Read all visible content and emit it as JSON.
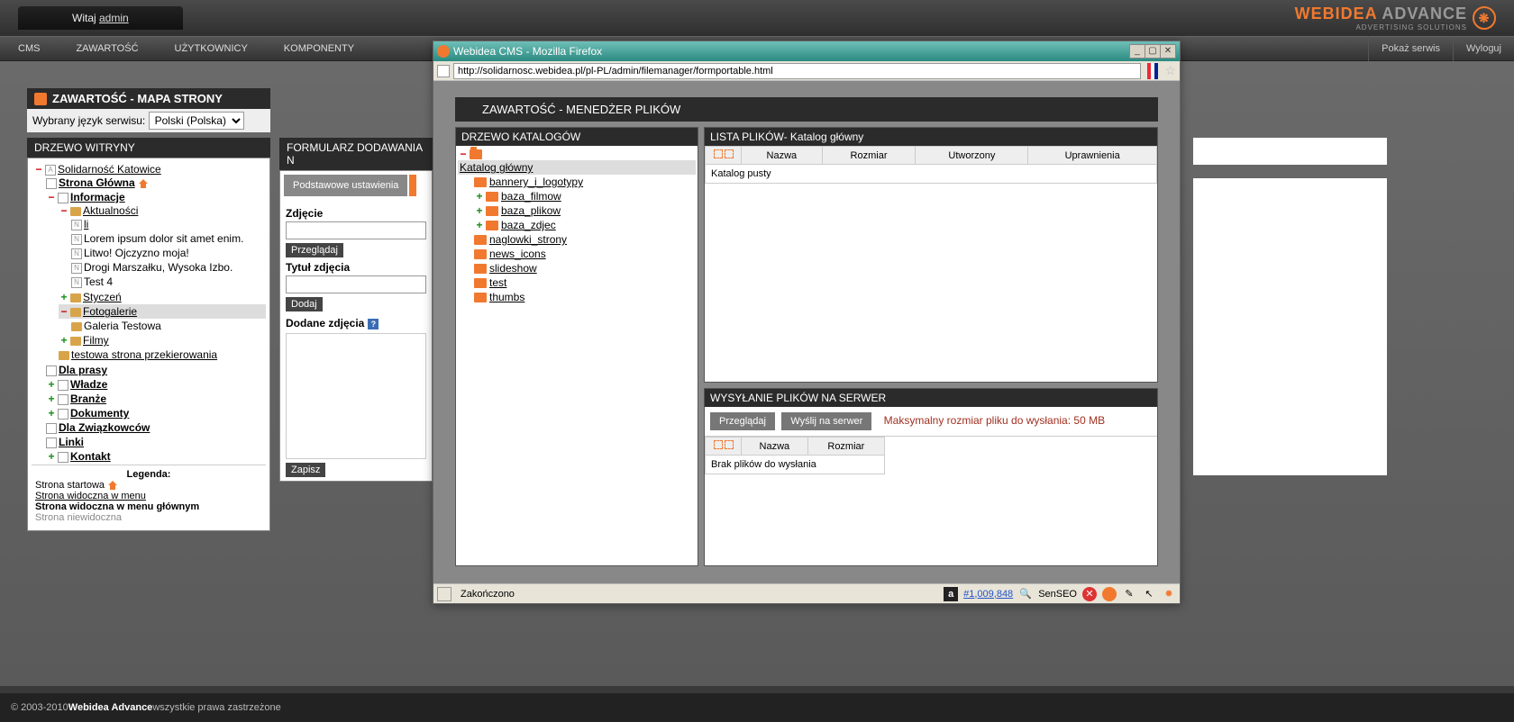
{
  "topbar": {
    "welcome_prefix": "Witaj ",
    "welcome_user": "admin"
  },
  "brand": {
    "name": "WEBIDEA",
    "name2": "ADVANCE",
    "sub": "ADVERTISING SOLUTIONS"
  },
  "menu": {
    "cms": "CMS",
    "zawartosc": "ZAWARTOŚĆ",
    "uzytkownicy": "UŻYTKOWNICY",
    "komponenty": "KOMPONENTY",
    "pokaz": "Pokaż serwis",
    "wyloguj": "Wyloguj"
  },
  "sitemap": {
    "header": "ZAWARTOŚĆ - MAPA STRONY",
    "lang_label": "Wybrany język serwisu:",
    "lang_value": "Polski (Polska)",
    "tree_header": "DRZEWO WITRYNY",
    "root": "Solidarność Katowice",
    "main_page": "Strona Główna",
    "info": "Informacje",
    "news": "Aktualności",
    "items": {
      "li": "li",
      "lorem": "Lorem ipsum dolor sit amet enim.",
      "litwo": "Litwo! Ojczyzno moja!",
      "drogi": "Drogi Marszałku, Wysoka Izbo.",
      "test4": "Test 4",
      "styczen": "Styczeń",
      "fotogalerie": "Fotogalerie",
      "galeria": "Galeria Testowa",
      "filmy": "Filmy",
      "testowa": "testowa strona przekierowania",
      "prasy": "Dla prasy",
      "wladze": "Władze",
      "branze": "Branże",
      "dokumenty": "Dokumenty",
      "zwiazkowcow": "Dla Związkowców",
      "linki": "Linki",
      "kontakt": "Kontakt"
    },
    "legend": {
      "title": "Legenda:",
      "l1": "Strona startowa",
      "l2": "Strona widoczna w menu",
      "l3": "Strona widoczna w menu głównym",
      "l4": "Strona niewidoczna"
    }
  },
  "form": {
    "header": "FORMULARZ DODAWANIA N",
    "tab1": "Podstawowe ustawienia",
    "zdjecie": "Zdjęcie",
    "browse": "Przeglądaj",
    "title": "Tytuł zdjęcia",
    "add": "Dodaj",
    "added": "Dodane zdjęcia",
    "save": "Zapisz"
  },
  "ffwin": {
    "title": "Webidea CMS - Mozilla Firefox",
    "url": "http://solidarnosc.webidea.pl/pl-PL/admin/filemanager/formportable.html",
    "content_header": "ZAWARTOŚĆ - MENEDŻER PLIKÓW",
    "dir_header": "DRZEWO KATALOGÓW",
    "dir_root": "Katalog główny",
    "dirs": {
      "bannery": "bannery_i_logotypy",
      "filmow": "baza_filmow",
      "plikow": "baza_plikow",
      "zdjec": "baza_zdjec",
      "naglowki": "naglowki_strony",
      "news": "news_icons",
      "slideshow": "slideshow",
      "test": "test",
      "thumbs": "thumbs"
    },
    "list_header": "LISTA PLIKÓW- Katalog główny",
    "cols": {
      "nazwa": "Nazwa",
      "rozmiar": "Rozmiar",
      "utworzony": "Utworzony",
      "uprawnienia": "Uprawnienia"
    },
    "empty": "Katalog pusty",
    "upload_header": "WYSYŁANIE PLIKÓW NA SERWER",
    "upload_browse": "Przeglądaj",
    "upload_send": "Wyślij na serwer",
    "upload_max": "Maksymalny rozmiar pliku do wysłania: 50 MB",
    "upload_cols": {
      "nazwa": "Nazwa",
      "rozmiar": "Rozmiar"
    },
    "upload_empty": "Brak plików do wysłania",
    "status_done": "Zakończono",
    "status_num": "#1,009,848",
    "senseo": "SenSEO"
  },
  "footer": {
    "copyright_prefix": "© 2003-2010 ",
    "brand": "Webidea Advance",
    "suffix": " wszystkie prawa zastrzeżone"
  }
}
